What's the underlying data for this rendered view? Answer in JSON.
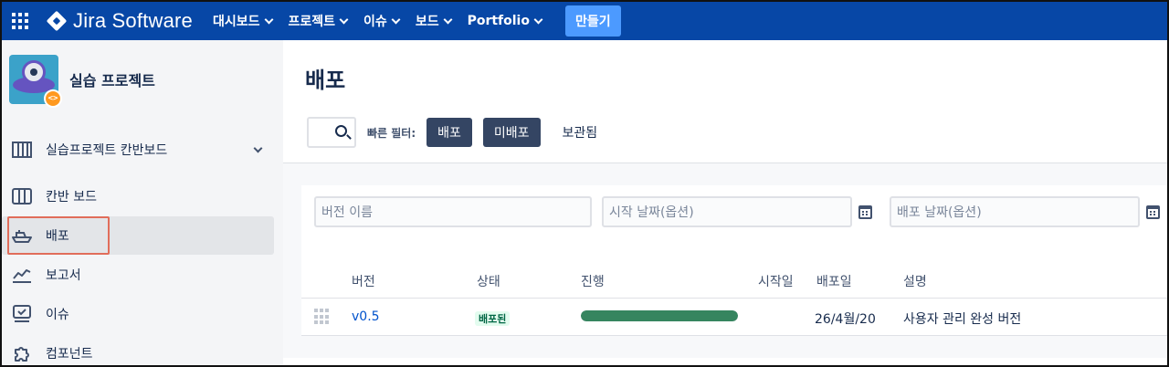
{
  "topbar": {
    "product_name": "Jira Software",
    "nav": [
      {
        "label": "대시보드"
      },
      {
        "label": "프로젝트"
      },
      {
        "label": "이슈"
      },
      {
        "label": "보드"
      },
      {
        "label": "Portfolio"
      }
    ],
    "create_label": "만들기",
    "bg_color": "#0747a6",
    "create_color": "#4c9aff"
  },
  "sidebar": {
    "project_name": "실습 프로젝트",
    "items": [
      {
        "label": "실습프로젝트 칸반보드",
        "icon": "board-columns-icon"
      },
      {
        "label": "칸반 보드",
        "icon": "kanban-board-icon"
      },
      {
        "label": "배포",
        "icon": "ship-icon",
        "active": true
      },
      {
        "label": "보고서",
        "icon": "chart-line-icon"
      },
      {
        "label": "이슈",
        "icon": "issues-icon"
      },
      {
        "label": "컴포넌트",
        "icon": "puzzle-icon"
      }
    ]
  },
  "main": {
    "title": "배포",
    "quick_filter_label": "빠른 필터:",
    "filters": [
      {
        "label": "배포",
        "selected": true
      },
      {
        "label": "미배포",
        "selected": true
      },
      {
        "label": "보관됨",
        "selected": false
      }
    ],
    "form": {
      "version_name_placeholder": "버전 이름",
      "start_date_placeholder": "시작 날짜(옵션)",
      "release_date_placeholder": "배포 날짜(옵션)"
    },
    "table": {
      "headers": {
        "version": "버전",
        "status": "상태",
        "progress": "진행",
        "start_date": "시작일",
        "release_date": "배포일",
        "description": "설명"
      },
      "rows": [
        {
          "version": "v0.5",
          "status": "배포된",
          "progress_percent": 100,
          "start_date": "",
          "release_date": "26/4월/20",
          "description": "사용자 관리 완성 버전"
        }
      ]
    },
    "colors": {
      "progress_done": "#36855f",
      "status_bg": "#e3fcef",
      "status_text": "#006644",
      "link": "#0052cc"
    }
  }
}
